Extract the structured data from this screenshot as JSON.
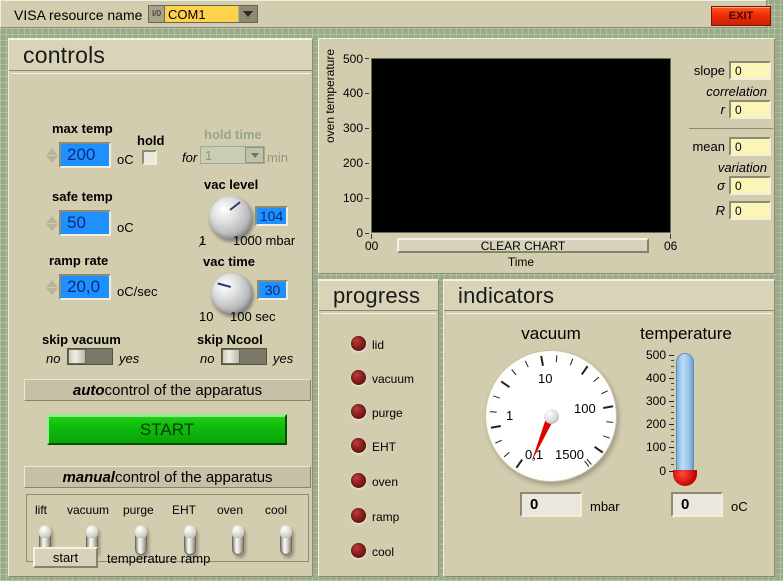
{
  "topbar": {
    "visa_label": "VISA resource name",
    "visa_io_icon": "io-icon",
    "visa_value": "COM1",
    "dropdown_icon": "chevron-down-icon",
    "exit_label": "EXIT"
  },
  "controls": {
    "title": "controls",
    "max_temp": {
      "label": "max temp",
      "value": "200",
      "unit": "oC"
    },
    "hold": {
      "label": "hold",
      "checked": false
    },
    "hold_time": {
      "label": "hold time",
      "for": "for",
      "value": "1",
      "unit": "min",
      "disabled": true
    },
    "safe_temp": {
      "label": "safe temp",
      "value": "50",
      "unit": "oC"
    },
    "ramp_rate": {
      "label": "ramp rate",
      "value": "20,0",
      "unit": "oC/sec"
    },
    "vac_level": {
      "label": "vac level",
      "value": "104",
      "min": "1",
      "max": "1000 mbar"
    },
    "vac_time": {
      "label": "vac  time",
      "value": "30",
      "min": "10",
      "max": "100 sec"
    },
    "skip_vacuum": {
      "label": "skip vacuum",
      "off": "no",
      "on": "yes",
      "state": "no"
    },
    "skip_ncool": {
      "label": "skip Ncool",
      "off": "no",
      "on": "yes",
      "state": "no"
    },
    "auto_header_bold": "auto",
    "auto_header_rest": " control of the apparatus",
    "start_label": "START",
    "manual_header_bold": "manual",
    "manual_header_rest": " control of the apparatus",
    "manual_switches": [
      "lift",
      "vacuum",
      "purge",
      "EHT",
      "oven",
      "cool"
    ],
    "ramp_button": "start",
    "ramp_button_label": "temperature ramp"
  },
  "chart_data": {
    "type": "line",
    "title": "",
    "xlabel": "Time",
    "ylabel": "oven temperature",
    "ylim": [
      0,
      500
    ],
    "yticks": [
      0,
      100,
      200,
      300,
      400,
      500
    ],
    "xticks": [
      "00",
      "06"
    ],
    "xlim": [
      "00",
      "06"
    ],
    "series": [],
    "grid": false,
    "legend": false,
    "plot_background": "#000000",
    "clear_button": "CLEAR CHART"
  },
  "stats": {
    "slope_label": "slope",
    "slope_value": "0",
    "correlation_label": "correlation",
    "r_label": "r",
    "r_value": "0",
    "mean_label": "mean",
    "mean_value": "0",
    "variation_label": "variation",
    "sigma_label": "σ",
    "sigma_value": "0",
    "R_label": "R",
    "R_value": "0"
  },
  "progress": {
    "title": "progress",
    "items": [
      "lid",
      "vacuum",
      "purge",
      "EHT",
      "oven",
      "ramp",
      "cool"
    ],
    "led_color_off": "#8c1f1c"
  },
  "indicators": {
    "title": "indicators",
    "vacuum": {
      "label": "vacuum",
      "scale": [
        "0,1",
        "1",
        "10",
        "100",
        "1500"
      ],
      "value": "0",
      "unit": "mbar",
      "needle_color": "#e00000"
    },
    "temperature": {
      "label": "temperature",
      "ticks": [
        0,
        100,
        200,
        300,
        400,
        500
      ],
      "value": "0",
      "unit": "oC",
      "fill_color": "#9cc8ec",
      "bulb_color": "#c00000"
    }
  }
}
